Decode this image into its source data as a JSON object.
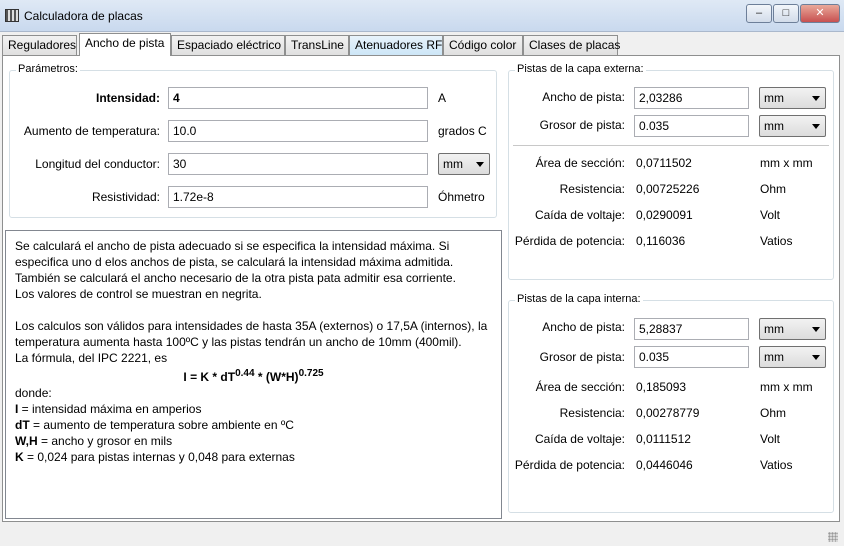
{
  "window": {
    "title": "Calculadora de placas",
    "btn_min": "–",
    "btn_max": "□",
    "btn_close": "✕"
  },
  "tabs": [
    {
      "label": "Reguladores"
    },
    {
      "label": "Ancho de pista"
    },
    {
      "label": "Espaciado eléctrico"
    },
    {
      "label": "TransLine"
    },
    {
      "label": "Atenuadores RF"
    },
    {
      "label": "Código color"
    },
    {
      "label": "Clases de placas"
    }
  ],
  "params": {
    "title": "Parámetros:",
    "intensity": {
      "label": "Intensidad:",
      "value": "4",
      "unit": "A"
    },
    "temp_rise": {
      "label": "Aumento de temperatura:",
      "value": "10.0",
      "unit": "grados C"
    },
    "length": {
      "label": "Longitud del conductor:",
      "value": "30",
      "unit": "mm"
    },
    "resistivity": {
      "label": "Resistividad:",
      "value": "1.72e-8",
      "unit": "Óhmetro"
    }
  },
  "external": {
    "title": "Pistas de la capa externa:",
    "width": {
      "label": "Ancho de pista:",
      "value": "2,03286",
      "unit": "mm"
    },
    "thickness": {
      "label": "Grosor de pista:",
      "value": "0.035",
      "unit": "mm"
    },
    "area": {
      "label": "Área de sección:",
      "value": "0,0711502",
      "unit": "mm x mm"
    },
    "resistance": {
      "label": "Resistencia:",
      "value": "0,00725226",
      "unit": "Ohm"
    },
    "voltage_drop": {
      "label": "Caída de voltaje:",
      "value": "0,0290091",
      "unit": "Volt"
    },
    "power_loss": {
      "label": "Pérdida de potencia:",
      "value": "0,116036",
      "unit": "Vatios"
    }
  },
  "internal": {
    "title": "Pistas de la capa interna:",
    "width": {
      "label": "Ancho de pista:",
      "value": "5,28837",
      "unit": "mm"
    },
    "thickness": {
      "label": "Grosor de pista:",
      "value": "0.035",
      "unit": "mm"
    },
    "area": {
      "label": "Área de sección:",
      "value": "0,185093",
      "unit": "mm x mm"
    },
    "resistance": {
      "label": "Resistencia:",
      "value": "0,00278779",
      "unit": "Ohm"
    },
    "voltage_drop": {
      "label": "Caída de voltaje:",
      "value": "0,0111512",
      "unit": "Volt"
    },
    "power_loss": {
      "label": "Pérdida de potencia:",
      "value": "0,0446046",
      "unit": "Vatios"
    }
  },
  "description": {
    "p1": "Se calculará el ancho de pista adecuado si se especifica la intensidad máxima. Si especifica uno d elos anchos de pista, se calculará la intensidad máxima admitida. También se calculará el ancho necesario de la otra pista pata admitir esa corriente.",
    "p2": "Los valores de control se muestran en negrita.",
    "p3": "Los calculos son válidos para intensidades de hasta 35A (externos) o 17,5A (internos), la temperatura aumenta hasta 100ºC y las pistas tendrán un ancho de 10mm (400mil).",
    "p4": "La fórmula, del IPC 2221, es",
    "formula_a": "I = K * dT",
    "formula_exp1": "0.44",
    "formula_b": " * (W*H)",
    "formula_exp2": "0.725",
    "p5": "donde:",
    "def_i_sym": "I",
    "def_i": " = intensidad máxima en amperios",
    "def_dt_sym": "dT",
    "def_dt": " = aumento de temperatura sobre ambiente en ºC",
    "def_wh_sym": "W,H",
    "def_wh": " = ancho y grosor en mils",
    "def_k_sym": "K",
    "def_k": " = 0,024 para pistas internas y 0,048 para externas"
  }
}
